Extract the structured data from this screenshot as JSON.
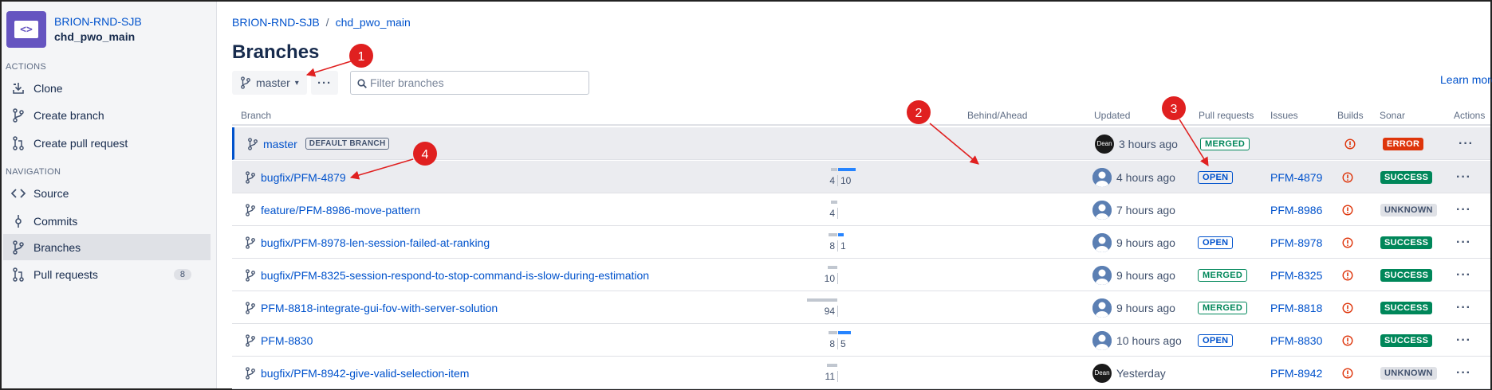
{
  "sidebar": {
    "project_key": "BRION-RND-SJB",
    "repo_name": "chd_pwo_main",
    "actions_label": "ACTIONS",
    "navigation_label": "NAVIGATION",
    "actions": [
      {
        "label": "Clone",
        "icon": "clone-icon"
      },
      {
        "label": "Create branch",
        "icon": "branch-icon"
      },
      {
        "label": "Create pull request",
        "icon": "pull-request-icon"
      }
    ],
    "navigation": [
      {
        "label": "Source",
        "icon": "code-icon"
      },
      {
        "label": "Commits",
        "icon": "commit-icon"
      },
      {
        "label": "Branches",
        "icon": "branch-icon",
        "active": true
      },
      {
        "label": "Pull requests",
        "icon": "pull-request-icon",
        "badge": "8"
      }
    ]
  },
  "breadcrumb": {
    "project": "BRION-RND-SJB",
    "separator": "/",
    "repo": "chd_pwo_main"
  },
  "page_title": "Branches",
  "toolbar": {
    "branch_selector": "master",
    "more_label": "···",
    "filter_placeholder": "Filter branches",
    "learn_more": "Learn more"
  },
  "table": {
    "headers": {
      "branch": "Branch",
      "behind_ahead": "Behind/Ahead",
      "updated": "Updated",
      "pull_requests": "Pull requests",
      "issues": "Issues",
      "builds": "Builds",
      "sonar": "Sonar",
      "actions": "Actions"
    },
    "default_branch_label": "DEFAULT BRANCH",
    "rows": [
      {
        "branch": "master",
        "is_default": true,
        "behind": null,
        "ahead": null,
        "avatar": "Dean",
        "updated": "3 hours ago",
        "pr": "MERGED",
        "issue": "",
        "sonar": "ERROR"
      },
      {
        "branch": "bugfix/PFM-4879",
        "behind": 4,
        "ahead": 10,
        "avatar": "",
        "updated": "4 hours ago",
        "pr": "OPEN",
        "issue": "PFM-4879",
        "sonar": "SUCCESS"
      },
      {
        "branch": "feature/PFM-8986-move-pattern",
        "behind": 4,
        "ahead": 0,
        "avatar": "",
        "updated": "7 hours ago",
        "pr": "",
        "issue": "PFM-8986",
        "sonar": "UNKNOWN"
      },
      {
        "branch": "bugfix/PFM-8978-len-session-failed-at-ranking",
        "behind": 8,
        "ahead": 1,
        "avatar": "",
        "updated": "9 hours ago",
        "pr": "OPEN",
        "issue": "PFM-8978",
        "sonar": "SUCCESS"
      },
      {
        "branch": "bugfix/PFM-8325-session-respond-to-stop-command-is-slow-during-estimation",
        "behind": 10,
        "ahead": 0,
        "avatar": "",
        "updated": "9 hours ago",
        "pr": "MERGED",
        "issue": "PFM-8325",
        "sonar": "SUCCESS"
      },
      {
        "branch": "PFM-8818-integrate-gui-fov-with-server-solution",
        "behind": 94,
        "ahead": 0,
        "avatar": "",
        "updated": "9 hours ago",
        "pr": "MERGED",
        "issue": "PFM-8818",
        "sonar": "SUCCESS"
      },
      {
        "branch": "PFM-8830",
        "behind": 8,
        "ahead": 5,
        "avatar": "",
        "updated": "10 hours ago",
        "pr": "OPEN",
        "issue": "PFM-8830",
        "sonar": "SUCCESS"
      },
      {
        "branch": "bugfix/PFM-8942-give-valid-selection-item",
        "behind": 11,
        "ahead": 0,
        "avatar": "Dean",
        "updated": "Yesterday",
        "pr": "",
        "issue": "PFM-8942",
        "sonar": "UNKNOWN"
      }
    ]
  },
  "annotations": [
    "1",
    "2",
    "3",
    "4"
  ],
  "colors": {
    "link": "#0052cc",
    "annotation_red": "#e02020",
    "project_avatar": "#6554c0",
    "ahead_bar": "#2684ff",
    "behind_bar": "#c1c7d0"
  }
}
